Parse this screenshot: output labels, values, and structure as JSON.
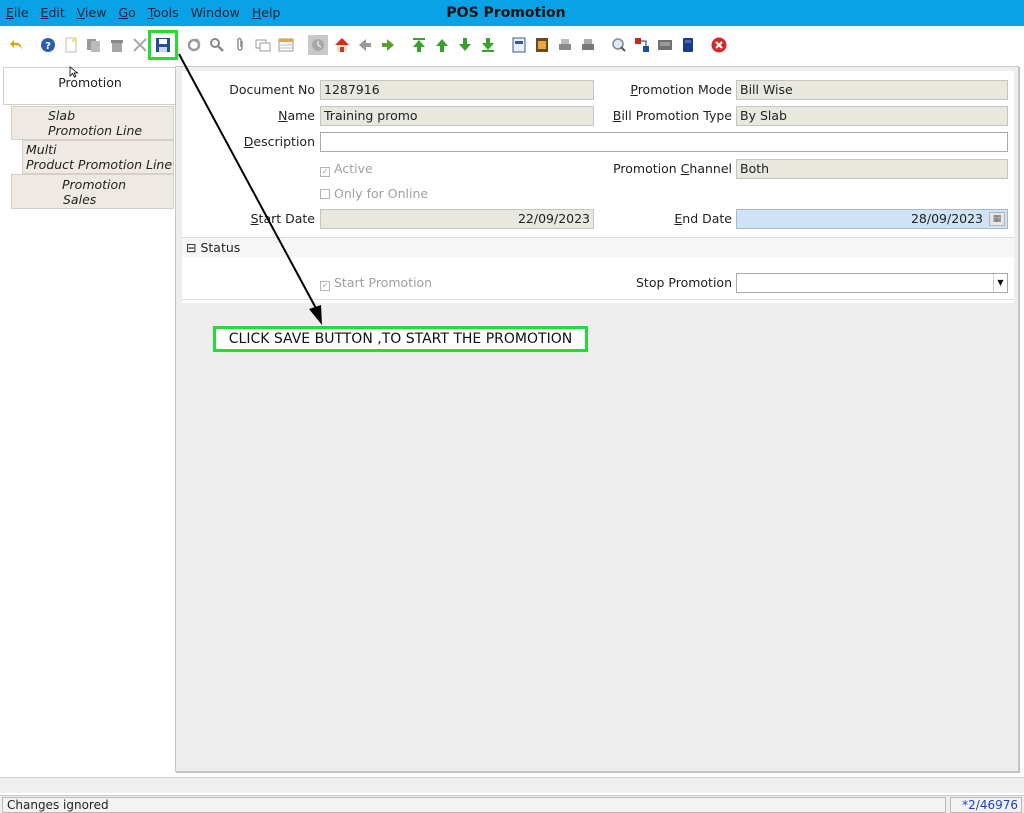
{
  "window": {
    "title": "POS Promotion"
  },
  "menu": [
    {
      "key": "E",
      "rest": "ile"
    },
    {
      "key": "E",
      "rest": "dit"
    },
    {
      "key": "V",
      "rest": "iew"
    },
    {
      "key": "G",
      "rest": "o"
    },
    {
      "key": "T",
      "rest": "ools"
    },
    {
      "key": "",
      "rest": "Window"
    },
    {
      "key": "H",
      "rest": "elp"
    }
  ],
  "toolbar_icons": [
    "undo-icon",
    "help-icon",
    "new-record-icon",
    "copy-record-icon",
    "delete-icon",
    "delete-selection-icon",
    "save-icon",
    "refresh-icon",
    "find-icon",
    "attachment-icon",
    "chat-icon",
    "grid-toggle-icon",
    "history-icon",
    "home-icon",
    "parent-record-icon",
    "detail-record-icon",
    "first-record-icon",
    "previous-record-icon",
    "next-record-icon",
    "last-record-icon",
    "report-icon",
    "archive-icon",
    "print-preview-icon",
    "print-icon",
    "zoom-across-icon",
    "workflow-icon",
    "product-info-icon",
    "request-icon",
    "close-window-icon"
  ],
  "tabs": [
    {
      "line1": "Promotion",
      "line2": ""
    },
    {
      "line1": "Slab",
      "line2": "Promotion Line"
    },
    {
      "line1": "Multi",
      "line2": "Product Promotion Line"
    },
    {
      "line1": "Promotion",
      "line2": "Sales"
    }
  ],
  "form": {
    "document_no": {
      "label": "Document No",
      "value": "1287916"
    },
    "name": {
      "label_key": "N",
      "label_rest": "ame",
      "value": "Training promo"
    },
    "description": {
      "label_key": "D",
      "label_rest": "escription",
      "value": ""
    },
    "active": {
      "label": "Active",
      "checked": true
    },
    "only_online": {
      "label": "Only for Online",
      "checked": false
    },
    "start_date": {
      "label_key": "S",
      "label_rest": "tart Date",
      "value": "22/09/2023"
    },
    "promotion_mode": {
      "label_key": "P",
      "label_rest": "romotion Mode",
      "value": "Bill Wise"
    },
    "bill_promotion_type": {
      "label_key": "B",
      "label_rest": "ill Promotion Type",
      "value": "By Slab"
    },
    "promotion_channel": {
      "label_pre": "Promotion ",
      "label_key": "C",
      "label_rest": "hannel",
      "value": "Both"
    },
    "end_date": {
      "label_key": "E",
      "label_rest": "nd Date",
      "value": "28/09/2023"
    }
  },
  "status_section": {
    "toggle": "⊟",
    "title": "Status",
    "start_promotion": {
      "label": "Start Promotion",
      "checked": true
    },
    "stop_promotion": {
      "label": "Stop Promotion",
      "value": ""
    }
  },
  "annotation": {
    "text": "CLICK SAVE BUTTON ,TO START THE PROMOTION",
    "color": "#22dd33"
  },
  "statusbar": {
    "message": "Changes ignored",
    "record": "*2/46976"
  },
  "colors": {
    "menubar": "#0aa2e6",
    "readonly_field": "#e8e8de",
    "highlight": "#22dd33",
    "date_field": "#cfe3f6"
  }
}
